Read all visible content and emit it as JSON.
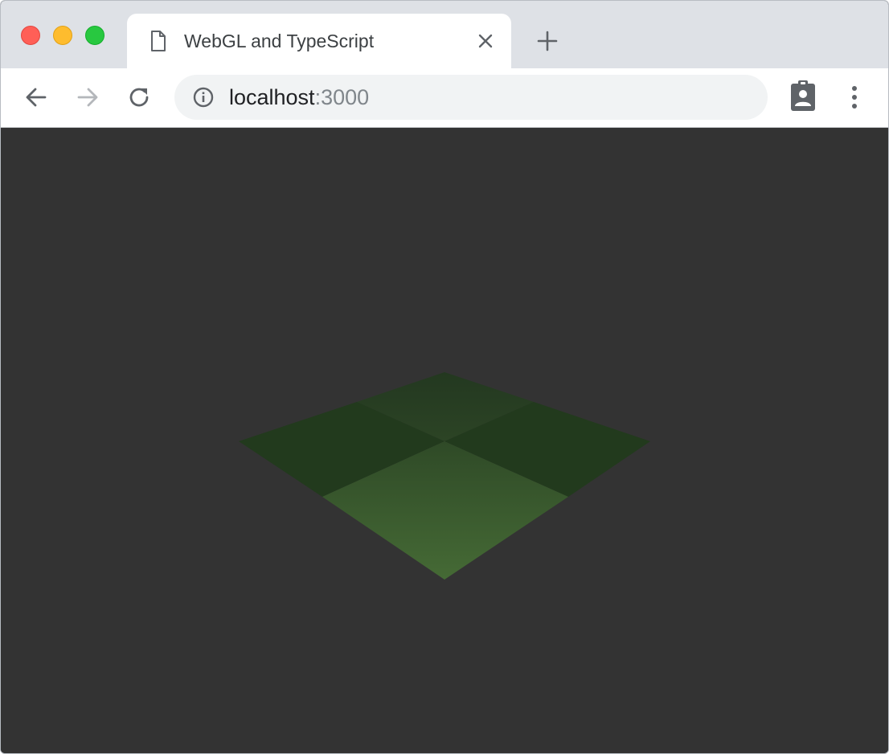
{
  "window": {
    "controls": [
      "close",
      "minimize",
      "maximize"
    ]
  },
  "tab": {
    "title": "WebGL and TypeScript",
    "icon": "document-icon",
    "close_icon": "close-icon"
  },
  "new_tab_icon": "plus-icon",
  "toolbar": {
    "back_icon": "arrow-left-icon",
    "forward_icon": "arrow-right-icon",
    "reload_icon": "reload-icon",
    "info_icon": "info-icon",
    "url_host": "localhost",
    "url_port": ":3000",
    "extension_icon": "clipboard-person-icon",
    "menu_icon": "kebab-menu-icon"
  },
  "content": {
    "background": "#333333",
    "scene": "green checkered plane"
  },
  "colors": {
    "tabstrip": "#dee1e6",
    "close_dot": "#ff5f57",
    "minimize_dot": "#febc2e",
    "maximize_dot": "#28c840",
    "plane_dark": "#243a1e",
    "plane_light": "#3a5a2e"
  }
}
